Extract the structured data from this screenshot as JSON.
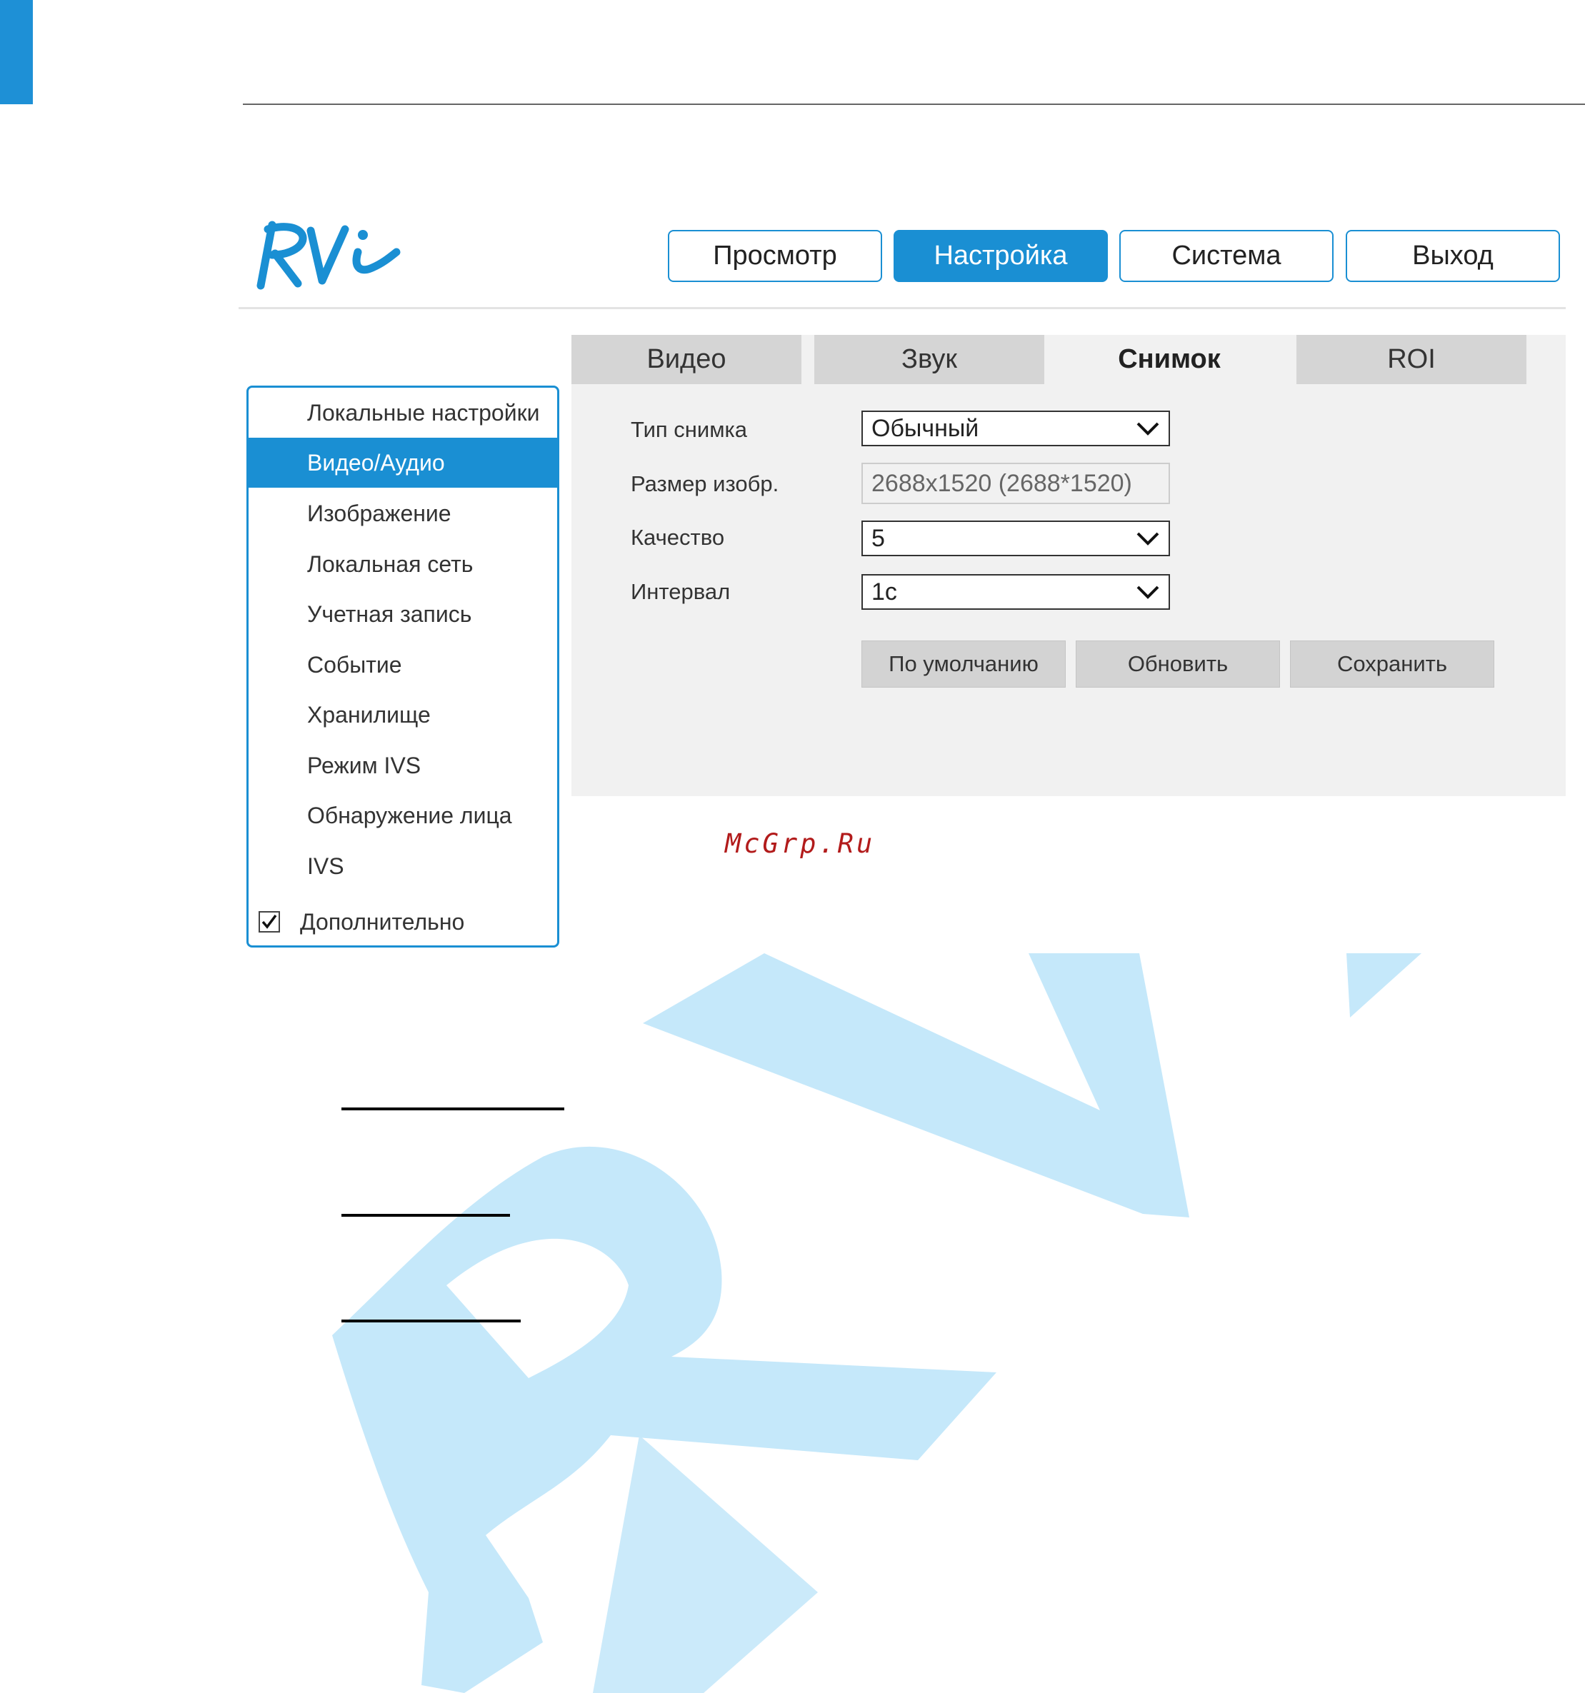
{
  "nav": {
    "items": [
      {
        "label": "Просмотр",
        "active": false
      },
      {
        "label": "Настройка",
        "active": true
      },
      {
        "label": "Система",
        "active": false
      },
      {
        "label": "Выход",
        "active": false
      }
    ]
  },
  "logo": {
    "text": "RVi"
  },
  "sidebar": {
    "items": [
      {
        "label": "Локальные настройки",
        "active": false
      },
      {
        "label": "Видео/Аудио",
        "active": true
      },
      {
        "label": "Изображение",
        "active": false
      },
      {
        "label": "Локальная сеть",
        "active": false
      },
      {
        "label": "Учетная запись",
        "active": false
      },
      {
        "label": "Событие",
        "active": false
      },
      {
        "label": "Хранилище",
        "active": false
      },
      {
        "label": "Режим IVS",
        "active": false
      },
      {
        "label": "Обнаружение лица",
        "active": false
      },
      {
        "label": "IVS",
        "active": false
      }
    ],
    "advanced": {
      "label": "Дополнительно",
      "checked": true
    }
  },
  "tabs": [
    {
      "label": "Видео",
      "active": false
    },
    {
      "label": "Звук",
      "active": false
    },
    {
      "label": "Снимок",
      "active": true
    },
    {
      "label": "ROI",
      "active": false
    }
  ],
  "form": {
    "snapshot_type": {
      "label": "Тип снимка",
      "value": "Обычный"
    },
    "image_size": {
      "label": "Размер изобр.",
      "value": "2688x1520 (2688*1520)"
    },
    "quality": {
      "label": "Качество",
      "value": "5"
    },
    "interval": {
      "label": "Интервал",
      "value": "1с"
    }
  },
  "actions": {
    "default_label": "По умолчанию",
    "refresh_label": "Обновить",
    "save_label": "Сохранить"
  },
  "site_mark": "McGrp.Ru",
  "colors": {
    "accent": "#1a8fd3",
    "watermark": "#c5e8fa",
    "site_mark": "#b21b1b"
  }
}
